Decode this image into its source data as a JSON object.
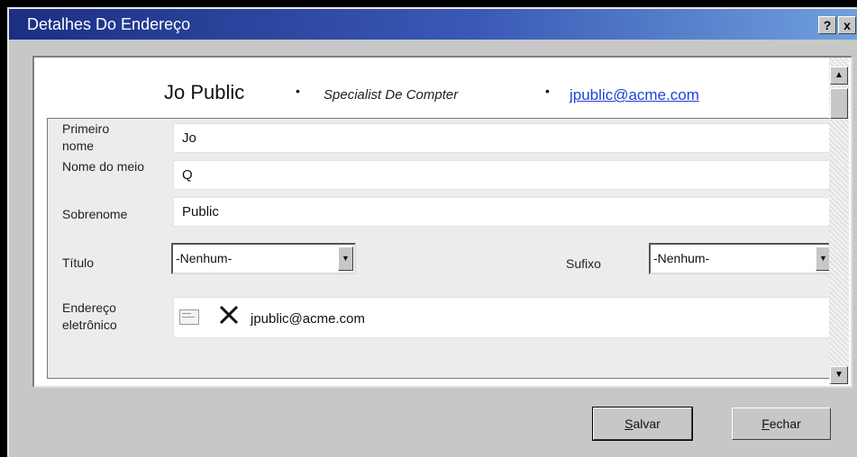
{
  "window": {
    "title": "Detalhes Do Endereço",
    "help_label": "?",
    "close_label": "x"
  },
  "header": {
    "name": "Jo Public",
    "separator": "•",
    "role": "Specialist De Compter",
    "email": "jpublic@acme.com"
  },
  "form": {
    "first_name": {
      "label": "Primeiro nome",
      "value": "Jo"
    },
    "middle_name": {
      "label": "Nome do meio",
      "value": "Q"
    },
    "last_name": {
      "label": "Sobrenome",
      "value": "Public"
    },
    "title": {
      "label": "Título",
      "selected": "-Nenhum-"
    },
    "suffix": {
      "label": "Sufixo",
      "selected": "-Nenhum-"
    },
    "email": {
      "label": "Endereço eletrônico",
      "value": "jpublic@acme.com"
    }
  },
  "buttons": {
    "save_mnemonic": "S",
    "save_rest": "alvar",
    "close_mnemonic": "F",
    "close_rest": "echar"
  },
  "icons": {
    "help": "question-icon",
    "close": "close-icon",
    "email_card": "email-card-icon",
    "delete": "delete-icon",
    "scroll_up": "arrow-up-icon",
    "scroll_down": "arrow-down-icon",
    "dropdown": "chevron-down-icon"
  }
}
